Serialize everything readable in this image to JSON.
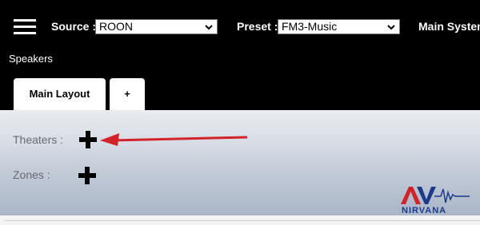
{
  "header": {
    "source_label": "Source :",
    "source_value": "ROON",
    "preset_label": "Preset :",
    "preset_value": "FM3-Music",
    "zone_label": "Main System"
  },
  "breadcrumb": "Speakers",
  "tabs": [
    {
      "label": "Main Layout"
    },
    {
      "label": "+"
    }
  ],
  "rows": {
    "theaters": "Theaters :",
    "zones": "Zones :"
  },
  "annotation": {
    "arrow_color": "#d2232a"
  },
  "watermark": {
    "text": "AV NIRVANA",
    "color": "#1d3a8a",
    "accent": "#d2232a"
  }
}
